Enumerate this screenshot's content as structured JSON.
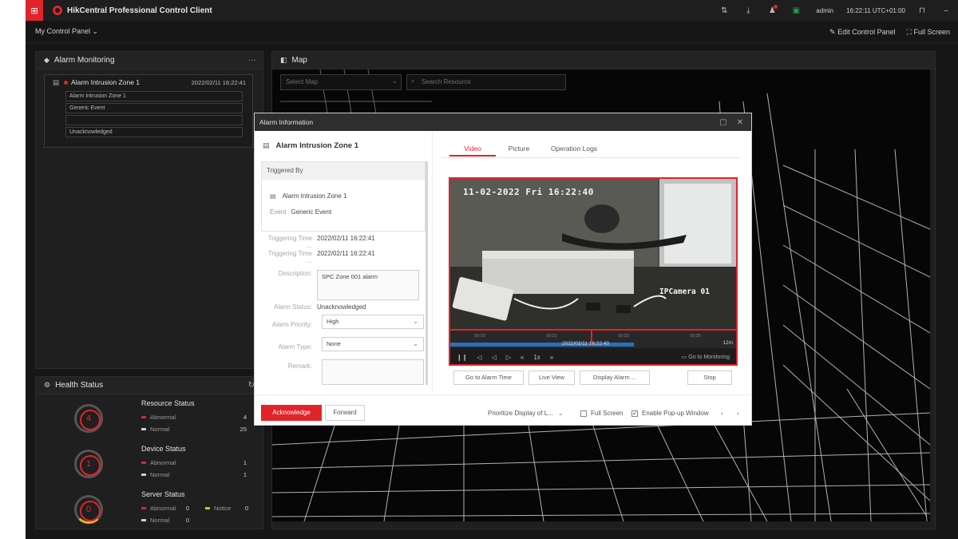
{
  "topbar": {
    "menu_icon": "grid-icon",
    "title": "HikCentral Professional Control Client",
    "user": "admin",
    "time": "16:22:11 UTC+01:00"
  },
  "subbar": {
    "panel_label": "My Control Panel",
    "edit_label": "Edit Control Panel",
    "fullscreen_label": "Full Screen"
  },
  "alarm_monitoring": {
    "title": "Alarm Monitoring",
    "more": "···",
    "card": {
      "name": "Alarm Intrusion Zone 1",
      "time": "2022/02/11 16:22:41",
      "field1": "Alarm Intrusion Zone 1",
      "field2": "Generic Event",
      "field3": "",
      "field4": "Unacknowledged"
    }
  },
  "health": {
    "title": "Health Status",
    "resource": {
      "title": "Resource Status",
      "count": "4",
      "abnormal_label": "Abnormal",
      "abnormal": "4",
      "normal_label": "Normal",
      "normal": "25"
    },
    "device": {
      "title": "Device Status",
      "count": "1",
      "abnormal_label": "Abnormal",
      "abnormal": "1",
      "normal_label": "Normal",
      "normal": "1"
    },
    "server": {
      "title": "Server Status",
      "count": "0",
      "abnormal_label": "Abnormal",
      "abnormal": "0",
      "notice_label": "Notice",
      "notice": "0",
      "normal_label": "Normal",
      "normal": "0"
    }
  },
  "map": {
    "title": "Map",
    "select_placeholder": "Select Map",
    "search_placeholder": "Search Resource"
  },
  "modal": {
    "title": "Alarm Information",
    "alarm_name": "Alarm Intrusion Zone 1",
    "triggered_by_label": "Triggered By",
    "triggered_source": "Alarm Intrusion Zone 1",
    "event_label": "Event",
    "event_value": "Generic Event",
    "trigger_time_label_1": "Triggering Time ...",
    "trigger_time_1": "2022/02/11 16:22:41",
    "trigger_time_label_2": "Triggering Time ...",
    "trigger_time_2": "2022/02/11 16:22:41",
    "description_label": "Description:",
    "description": "SPC Zone 001 alarm",
    "status_label": "Alarm Status:",
    "status": "Unacknowledged",
    "priority_label": "Alarm Priority:",
    "priority": "High",
    "type_label": "Alarm Type:",
    "type": "None",
    "remark_label": "Remark:",
    "tabs": [
      "Video",
      "Picture",
      "Operation Logs"
    ],
    "video": {
      "osd_time": "11-02-2022 Fri 16:22:40",
      "camera_name": "IPCamera 01",
      "timeline_time": "2022/02/11 16:22:40",
      "ticks": [
        "16:19",
        "16:21",
        "16:23",
        "16:25",
        "16:27"
      ],
      "zoom": "12m",
      "goto_monitoring": "Go to Monitoring"
    },
    "buttons": {
      "goto_alarm_time": "Go to Alarm Time",
      "live_view": "Live View",
      "display_alarm": "Display Alarm ...",
      "stop": "Stop"
    },
    "footer": {
      "acknowledge": "Acknowledge",
      "forward": "Forward",
      "prioritize": "Prioritize Display of L...",
      "full_screen": "Full Screen",
      "enable_popup": "Enable Pop-up Window"
    }
  },
  "colors": {
    "accent": "#e0242a",
    "notice": "#e6b422",
    "timeline_blue": "#2a6fbf"
  }
}
